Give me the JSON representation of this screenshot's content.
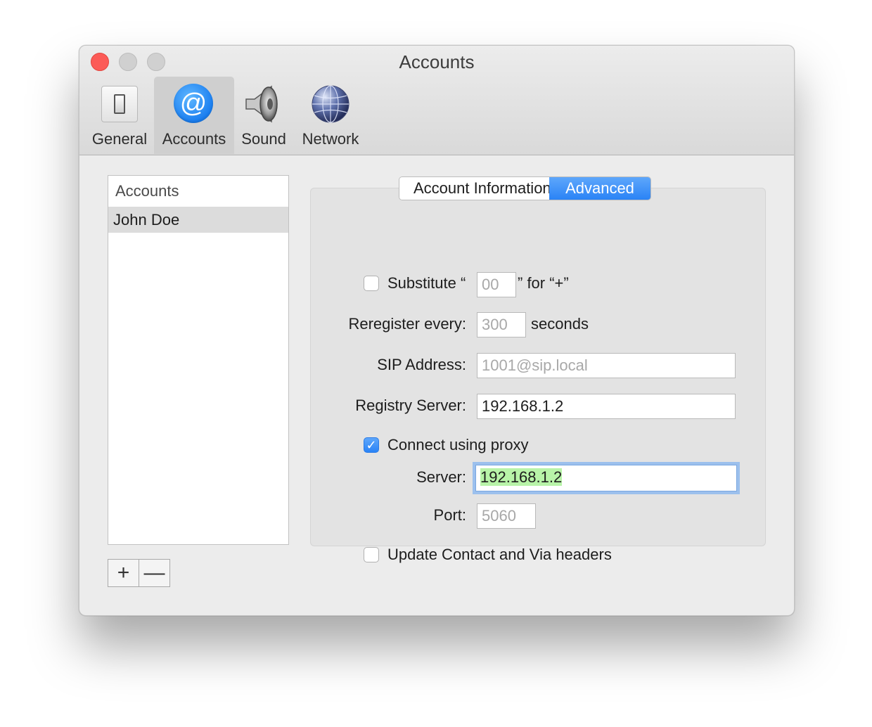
{
  "window": {
    "title": "Accounts"
  },
  "toolbar": {
    "items": [
      {
        "label": "General",
        "icon": "switch-icon"
      },
      {
        "label": "Accounts",
        "icon": "at-sign-icon",
        "selected": true
      },
      {
        "label": "Sound",
        "icon": "speaker-icon"
      },
      {
        "label": "Network",
        "icon": "globe-icon"
      }
    ]
  },
  "accounts_list": {
    "header": "Accounts",
    "items": [
      "John Doe"
    ],
    "add_label": "+",
    "remove_label": "—"
  },
  "tabs": {
    "items": [
      "Account Information",
      "Advanced"
    ],
    "selected": "Advanced"
  },
  "advanced": {
    "substitute": {
      "checked": false,
      "prefix": "Substitute “",
      "placeholder": "00",
      "suffix": "” for “+”"
    },
    "reregister": {
      "label": "Reregister every:",
      "placeholder": "300",
      "unit": "seconds"
    },
    "sip_address": {
      "label": "SIP Address:",
      "placeholder": "1001@sip.local"
    },
    "registry_server": {
      "label": "Registry Server:",
      "value": "192.168.1.2"
    },
    "proxy": {
      "checked": true,
      "label": "Connect using proxy",
      "checkmark": "✓",
      "server_label": "Server:",
      "server_value": "192.168.1.2",
      "port_label": "Port:",
      "port_placeholder": "5060"
    },
    "update_headers": {
      "checked": false,
      "label": "Update Contact and Via headers"
    }
  },
  "colors": {
    "accent": "#2a83f6",
    "close_button": "#fc5b57",
    "highlight": "#b8f3a8"
  }
}
